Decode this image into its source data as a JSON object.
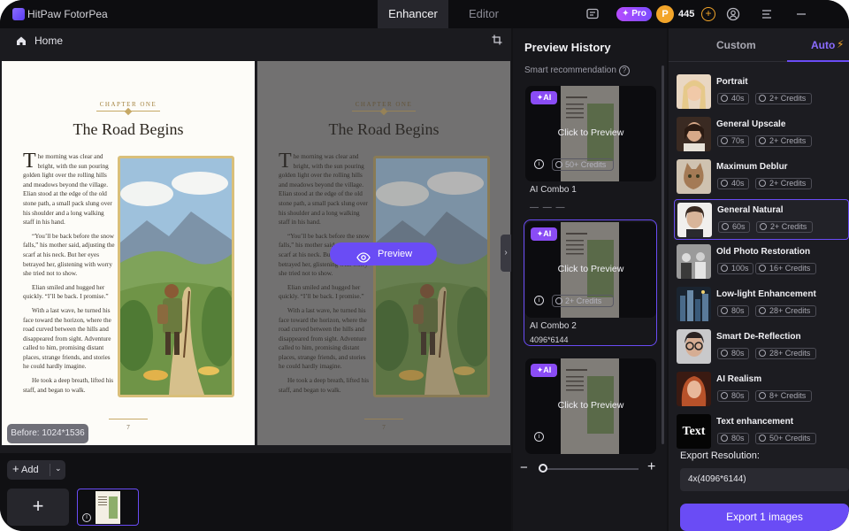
{
  "app": {
    "title": "HitPaw FotorPea"
  },
  "modes": [
    {
      "label": "Enhancer"
    },
    {
      "label": "Editor"
    }
  ],
  "topbar": {
    "pro_label": "Pro",
    "coin_symbol": "P",
    "coin_count": "445",
    "coin_add": "+"
  },
  "workspace": {
    "home_label": "Home",
    "before_label": "Before: 1024*1536",
    "preview_label": "Preview",
    "collapse_glyph": "›"
  },
  "book": {
    "chapter": "CHAPTER ONE",
    "title": "The Road Begins",
    "drop_cap": "T",
    "paragraphs": [
      "he morning was clear and bright, with the sun pouring golden light over the rolling hills and meadows beyond the village. Elian stood at the edge of the old stone path, a small pack slung over his shoulder and a long walking staff in his hand.",
      "“You’ll be back before the snow falls,” his mother said, adjusting the scarf at his neck. But her eyes betrayed her, glistening with worry she tried not to show.",
      "Elian smiled and hugged her quickly. “I’ll be back. I promise.”",
      "With a last wave, he turned his face toward the horizon, where the road curved between the hills and disappeared from sight. Adventure called to him, promising distant places, strange friends, and stories he could hardly imagine.",
      "He took a deep breath, lifted his staff, and began to walk."
    ],
    "page_number": "7"
  },
  "filmstrip": {
    "add_label": "Add",
    "add_plus": "+",
    "tile_plus": "+",
    "chevron": "⌄",
    "info": "i"
  },
  "history": {
    "title": "Preview History",
    "smart_label": "Smart recommendation",
    "help_glyph": "?",
    "ai_tag": "AI",
    "click_to_preview": "Click to Preview",
    "info": "i",
    "cards": [
      {
        "credits": "50+ Credits",
        "name": "AI Combo 1",
        "size": "— — —"
      },
      {
        "credits": "2+ Credits",
        "name": "AI Combo 2",
        "size": "4096*6144"
      },
      {
        "credits": "",
        "name": "",
        "size": ""
      }
    ],
    "zoom": {
      "minus": "−",
      "plus": "+",
      "value": 0.0
    }
  },
  "panel": {
    "tabs": [
      {
        "label": "Custom"
      },
      {
        "label": "Auto"
      }
    ],
    "bolt": "⚡",
    "features": [
      {
        "name": "Portrait",
        "time": "40s",
        "credits": "2+ Credits",
        "icon": "portrait-thumb"
      },
      {
        "name": "General Upscale",
        "time": "70s",
        "credits": "2+ Credits",
        "icon": "upscale-thumb"
      },
      {
        "name": "Maximum Deblur",
        "time": "40s",
        "credits": "2+ Credits",
        "icon": "cat-thumb"
      },
      {
        "name": "General Natural",
        "time": "60s",
        "credits": "2+ Credits",
        "icon": "natural-thumb"
      },
      {
        "name": "Old Photo Restoration",
        "time": "100s",
        "credits": "16+ Credits",
        "icon": "old-photo-thumb"
      },
      {
        "name": "Low-light Enhancement",
        "time": "80s",
        "credits": "28+ Credits",
        "icon": "lowlight-thumb"
      },
      {
        "name": "Smart De-Reflection",
        "time": "80s",
        "credits": "28+ Credits",
        "icon": "glasses-thumb"
      },
      {
        "name": "AI Realism",
        "time": "80s",
        "credits": "8+ Credits",
        "icon": "realism-thumb"
      },
      {
        "name": "Text enhancement",
        "time": "80s",
        "credits": "50+ Credits",
        "icon": "text-thumb",
        "thumb_text": "Text"
      }
    ],
    "export_label": "Export Resolution:",
    "export_value": "4x(4096*6144)",
    "export_button": "Export 1 images"
  },
  "colors": {
    "accent": "#6a4cf5",
    "coin": "#f3a52a",
    "background": "#131316"
  }
}
